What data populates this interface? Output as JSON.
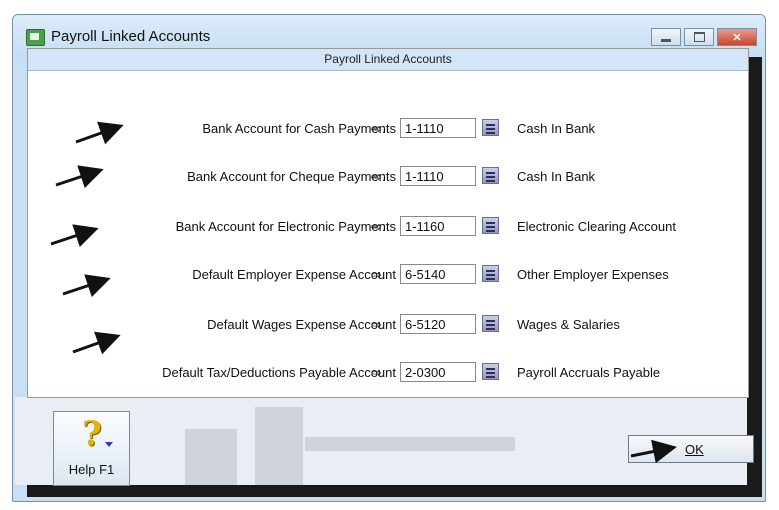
{
  "window": {
    "title": "Payroll Linked Accounts",
    "controls": {
      "minimize_icon": "minimize-icon",
      "maximize_icon": "maximize-icon",
      "close_label": "✕"
    }
  },
  "panel": {
    "header": "Payroll Linked Accounts"
  },
  "link_arrow": "⇨:",
  "rows": [
    {
      "label": "Bank Account for Cash Payments",
      "account": "1-1110",
      "name": "Cash In Bank"
    },
    {
      "label": "Bank Account for Cheque Payments",
      "account": "1-1110",
      "name": "Cash In Bank"
    },
    {
      "label": "Bank Account for Electronic Payments",
      "account": "1-1160",
      "name": "Electronic Clearing Account"
    },
    {
      "label": "Default Employer Expense Account",
      "account": "6-5140",
      "name": "Other Employer Expenses"
    },
    {
      "label": "Default Wages Expense Account",
      "account": "6-5120",
      "name": "Wages & Salaries"
    },
    {
      "label": "Default Tax/Deductions Payable Account",
      "account": "2-0300",
      "name": "Payroll Accruals Payable"
    }
  ],
  "buttons": {
    "help_symbol": "?",
    "help_label": "Help F1",
    "ok_label": "OK"
  },
  "colors": {
    "title_bar": "#c6ddf3",
    "panel_header": "#d3e5f7",
    "close_button": "#c7462f",
    "pointer_arrows": "#111111"
  }
}
